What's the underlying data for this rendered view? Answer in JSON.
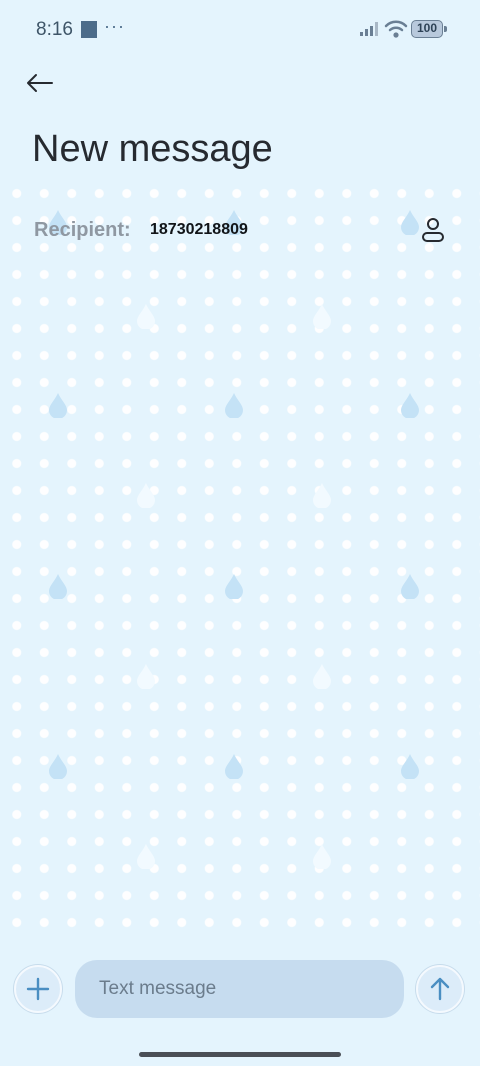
{
  "status_bar": {
    "time": "8:16",
    "overflow": "···",
    "battery": "100",
    "icons": [
      "signal-icon",
      "wifi-icon",
      "battery-icon"
    ]
  },
  "header": {
    "back_icon": "arrow-left-icon",
    "title": "New message"
  },
  "recipient": {
    "label": "Recipient:",
    "value": "18730218809",
    "contact_icon": "contact-icon"
  },
  "composer": {
    "add_icon": "plus-icon",
    "placeholder": "Text message",
    "value": "",
    "send_icon": "arrow-up-icon"
  },
  "colors": {
    "background": "#e4f4fd",
    "accent": "#4a8ec2",
    "input_fill": "#c6dcef"
  }
}
